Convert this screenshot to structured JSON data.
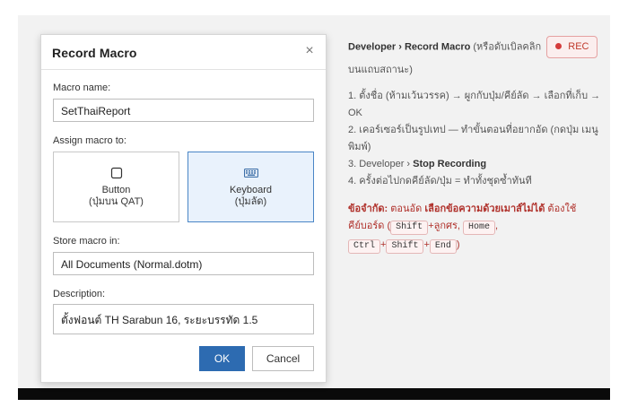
{
  "dialog": {
    "title": "Record Macro",
    "close_glyph": "×",
    "macro_name_label": "Macro name:",
    "macro_name_value": "SetThaiReport",
    "assign_label": "Assign macro to:",
    "assign_options": [
      {
        "icon": "button-icon",
        "label1": "Button",
        "label2": "(ปุ่มบน QAT)",
        "selected": false
      },
      {
        "icon": "keyboard-icon",
        "label1": "Keyboard",
        "label2": "(ปุ่มลัด)",
        "selected": true
      }
    ],
    "store_label": "Store macro in:",
    "store_value": "All Documents (Normal.dotm)",
    "description_label": "Description:",
    "description_value": "ตั้งฟอนต์ TH Sarabun 16, ระยะบรรทัด 1.5",
    "ok_label": "OK",
    "cancel_label": "Cancel"
  },
  "help": {
    "path_bold": "Developer › Record Macro",
    "path_rest": "(หรือดับเบิลคลิก",
    "rec_label": "REC",
    "path_tail": "บนแถบสถานะ)",
    "step1": "1. ตั้งชื่อ (ห้ามเว้นวรรค) → ผูกกับปุ่ม/คีย์ลัด → เลือกที่เก็บ → OK",
    "step2": "2. เคอร์เซอร์เป็นรูปเทป — ทำขั้นตอนที่อยากอัด (กดปุ่ม เมนู พิมพ์)",
    "step3_pre": "3. Developer ›",
    "step3_bold": "Stop Recording",
    "step4": "4. ครั้งต่อไปกดคีย์ลัด/ปุ่ม = ทำทั้งชุดซ้ำทันที",
    "warn_bold1": "ข้อจำกัด:",
    "warn_text1": "ตอนอัด",
    "warn_bold2": "เลือกข้อความด้วยเมาส์ไม่ได้",
    "warn_text2": "ต้องใช้คีย์บอร์ด (",
    "kbd_shift": "Shift",
    "warn_plus_arrows": "+ลูกศร,",
    "kbd_home": "Home",
    "warn_comma": ",",
    "kbd_ctrl": "Ctrl",
    "plus": "+",
    "kbd_end": "End",
    "close_paren": ")"
  },
  "colors": {
    "ok_button": "#2d6bb1",
    "warning": "#b0312b",
    "rec_dot": "#d43b3b",
    "selected_option": "#e9f2fc"
  }
}
